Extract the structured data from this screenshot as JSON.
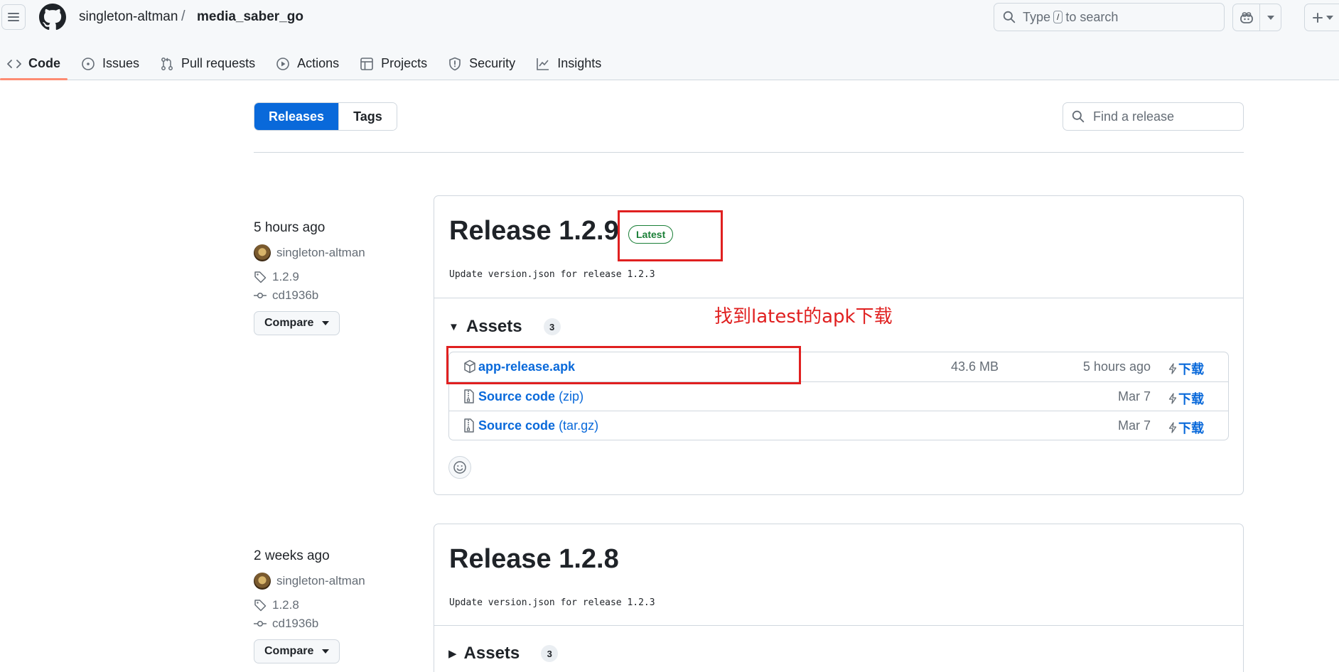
{
  "header": {
    "owner": "singleton-altman",
    "slash": "/",
    "repo": "media_saber_go",
    "search_pre": "Type",
    "search_key": "/",
    "search_post": "to search"
  },
  "tabs": [
    {
      "label": "Code",
      "icon": "code-icon",
      "active": true
    },
    {
      "label": "Issues",
      "icon": "issue-opened-icon"
    },
    {
      "label": "Pull requests",
      "icon": "git-pull-request-icon"
    },
    {
      "label": "Actions",
      "icon": "play-icon"
    },
    {
      "label": "Projects",
      "icon": "table-icon"
    },
    {
      "label": "Security",
      "icon": "shield-icon"
    },
    {
      "label": "Insights",
      "icon": "graph-icon"
    }
  ],
  "subnav": {
    "releases": "Releases",
    "tags": "Tags",
    "find_placeholder": "Find a release"
  },
  "releases": [
    {
      "when": "5 hours ago",
      "author": "singleton-altman",
      "tag": "1.2.9",
      "commit": "cd1936b",
      "compare": "Compare",
      "title": "Release 1.2.9",
      "badge": "Latest",
      "commit_msg": "Update version.json for release 1.2.3",
      "assets_label": "Assets",
      "assets_count": "3",
      "assets": [
        {
          "name": "app-release.apk",
          "ext": "",
          "size": "43.6 MB",
          "time": "5 hours ago",
          "dl": "下载",
          "icon": "package-icon"
        },
        {
          "name": "Source code",
          "ext": "(zip)",
          "size": "",
          "time": "Mar 7",
          "dl": "下载",
          "icon": "file-zip-icon"
        },
        {
          "name": "Source code",
          "ext": "(tar.gz)",
          "size": "",
          "time": "Mar 7",
          "dl": "下载",
          "icon": "file-zip-icon"
        }
      ]
    },
    {
      "when": "2 weeks ago",
      "author": "singleton-altman",
      "tag": "1.2.8",
      "commit": "cd1936b",
      "compare": "Compare",
      "title": "Release 1.2.8",
      "commit_msg": "Update version.json for release 1.2.3",
      "assets_label": "Assets",
      "assets_count": "3"
    }
  ],
  "annotation": {
    "text": "找到latest的apk下载",
    "color": "#e02020"
  },
  "colors": {
    "accent": "#0969da",
    "latest_green": "#1a7f37",
    "active_tab_underline": "#fd8c73"
  }
}
